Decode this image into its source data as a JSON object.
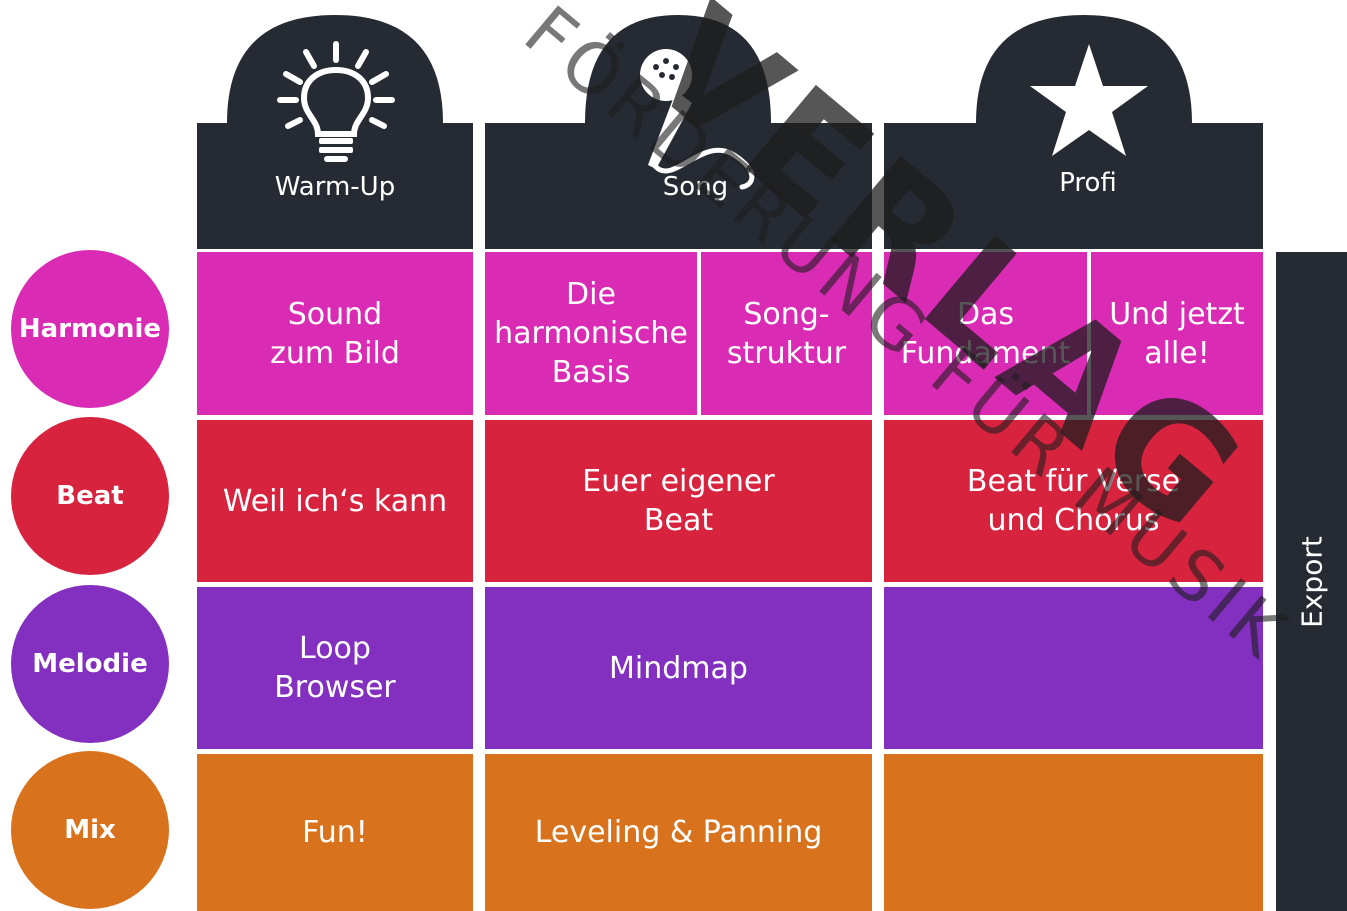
{
  "colors": {
    "dark": "#262a33",
    "harmonie": "#d92bb4",
    "beat": "#d8233f",
    "melodie": "#8330c0",
    "mix": "#d9721d",
    "watermark": "rgba(30,30,30,0.75)"
  },
  "columns": [
    {
      "label": "Warm-Up",
      "icon": "lightbulb-icon"
    },
    {
      "label": "Song",
      "icon": "microphone-icon"
    },
    {
      "label": "Profi",
      "icon": "star-icon"
    }
  ],
  "rows": [
    {
      "label": "Harmonie"
    },
    {
      "label": "Beat"
    },
    {
      "label": "Melodie"
    },
    {
      "label": "Mix"
    }
  ],
  "cells": {
    "harmonie_warmup": "Sound\nzum Bild",
    "harmonie_song_a": "Die\nharmonische\nBasis",
    "harmonie_song_b": "Song-\nstruktur",
    "harmonie_profi_a": "Das\nFundament",
    "harmonie_profi_b": "Und jetzt\nalle!",
    "beat_warmup": "Weil ich‘s kann",
    "beat_song": "Euer eigener\nBeat",
    "beat_profi": "Beat für Verse\nund Chorus",
    "melodie_warmup": "Loop\nBrowser",
    "melodie_song": "Mindmap",
    "melodie_profi": "",
    "mix_warmup": "Fun!",
    "mix_song": "Leveling & Panning",
    "mix_profi": ""
  },
  "export_label": "Export",
  "watermark": {
    "line1": "HELBLING VERLAG",
    "line2": "FÖRDERUNG FÜR MUSIK"
  }
}
